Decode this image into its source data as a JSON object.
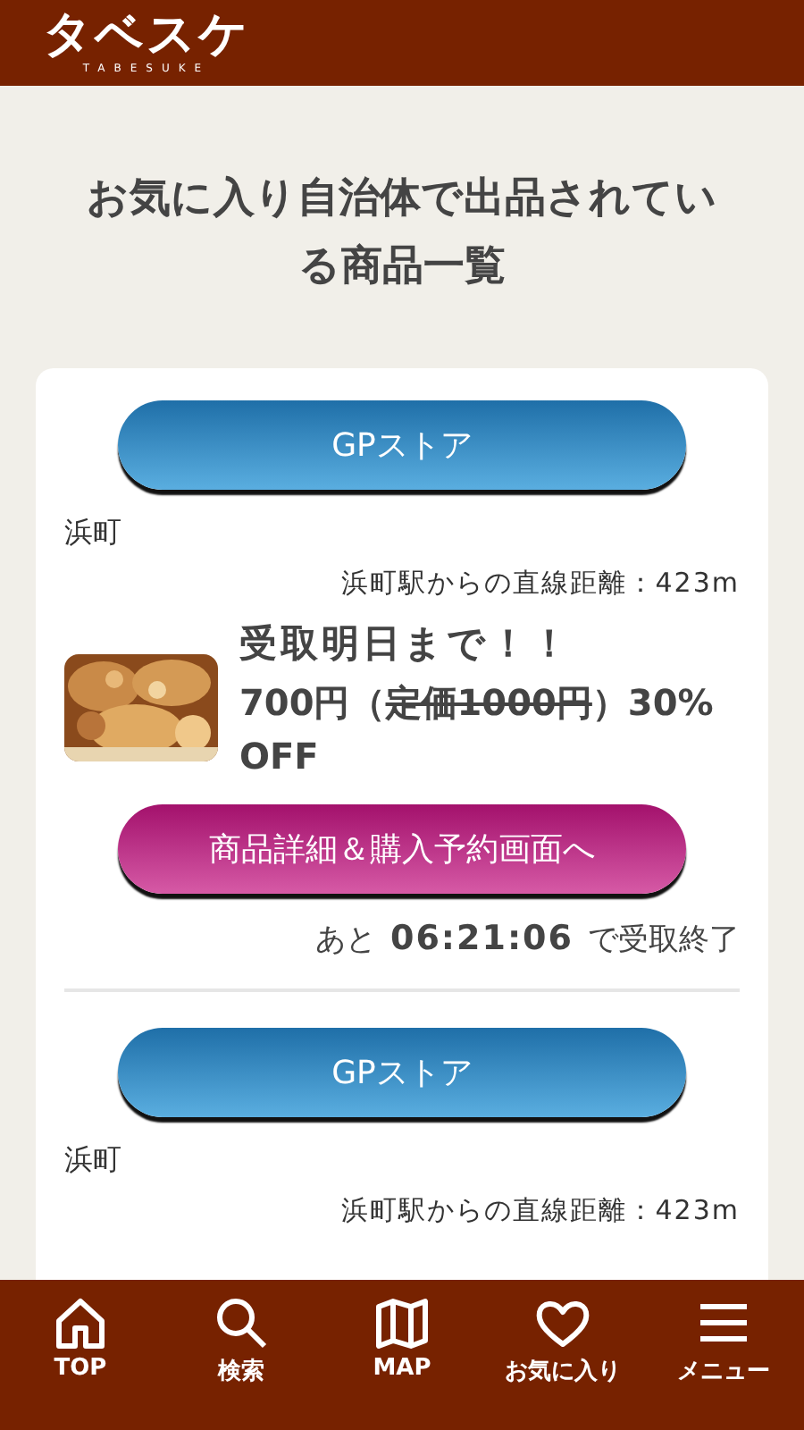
{
  "header": {
    "logo": "タベスケ",
    "logo_sub": "TABESUKE"
  },
  "page_title": "お気に入り自治体で出品されている商品一覧",
  "products": [
    {
      "store": "GPストア",
      "area": "浜町",
      "distance": "浜町駅からの直線距離：423m",
      "deadline": "受取明日まで！！",
      "price_parts": [
        {
          "text": "700円（",
          "struck": false
        },
        {
          "text": "定価1000円",
          "struck": true
        },
        {
          "text": "）30% OFF",
          "struck": false
        }
      ],
      "detail_button": "商品詳細＆購入予約画面へ",
      "remaining_prefix": "あと",
      "remaining_time": "06:21:06",
      "remaining_suffix": "で受取終了"
    },
    {
      "store": "GPストア",
      "area": "浜町",
      "distance": "浜町駅からの直線距離：423m"
    }
  ],
  "nav": [
    {
      "kind": "home",
      "label": "TOP"
    },
    {
      "kind": "search",
      "label": "検索"
    },
    {
      "kind": "map",
      "label": "MAP"
    },
    {
      "kind": "heart",
      "label": "お気に入り"
    },
    {
      "kind": "menu",
      "label": "メニュー"
    }
  ]
}
